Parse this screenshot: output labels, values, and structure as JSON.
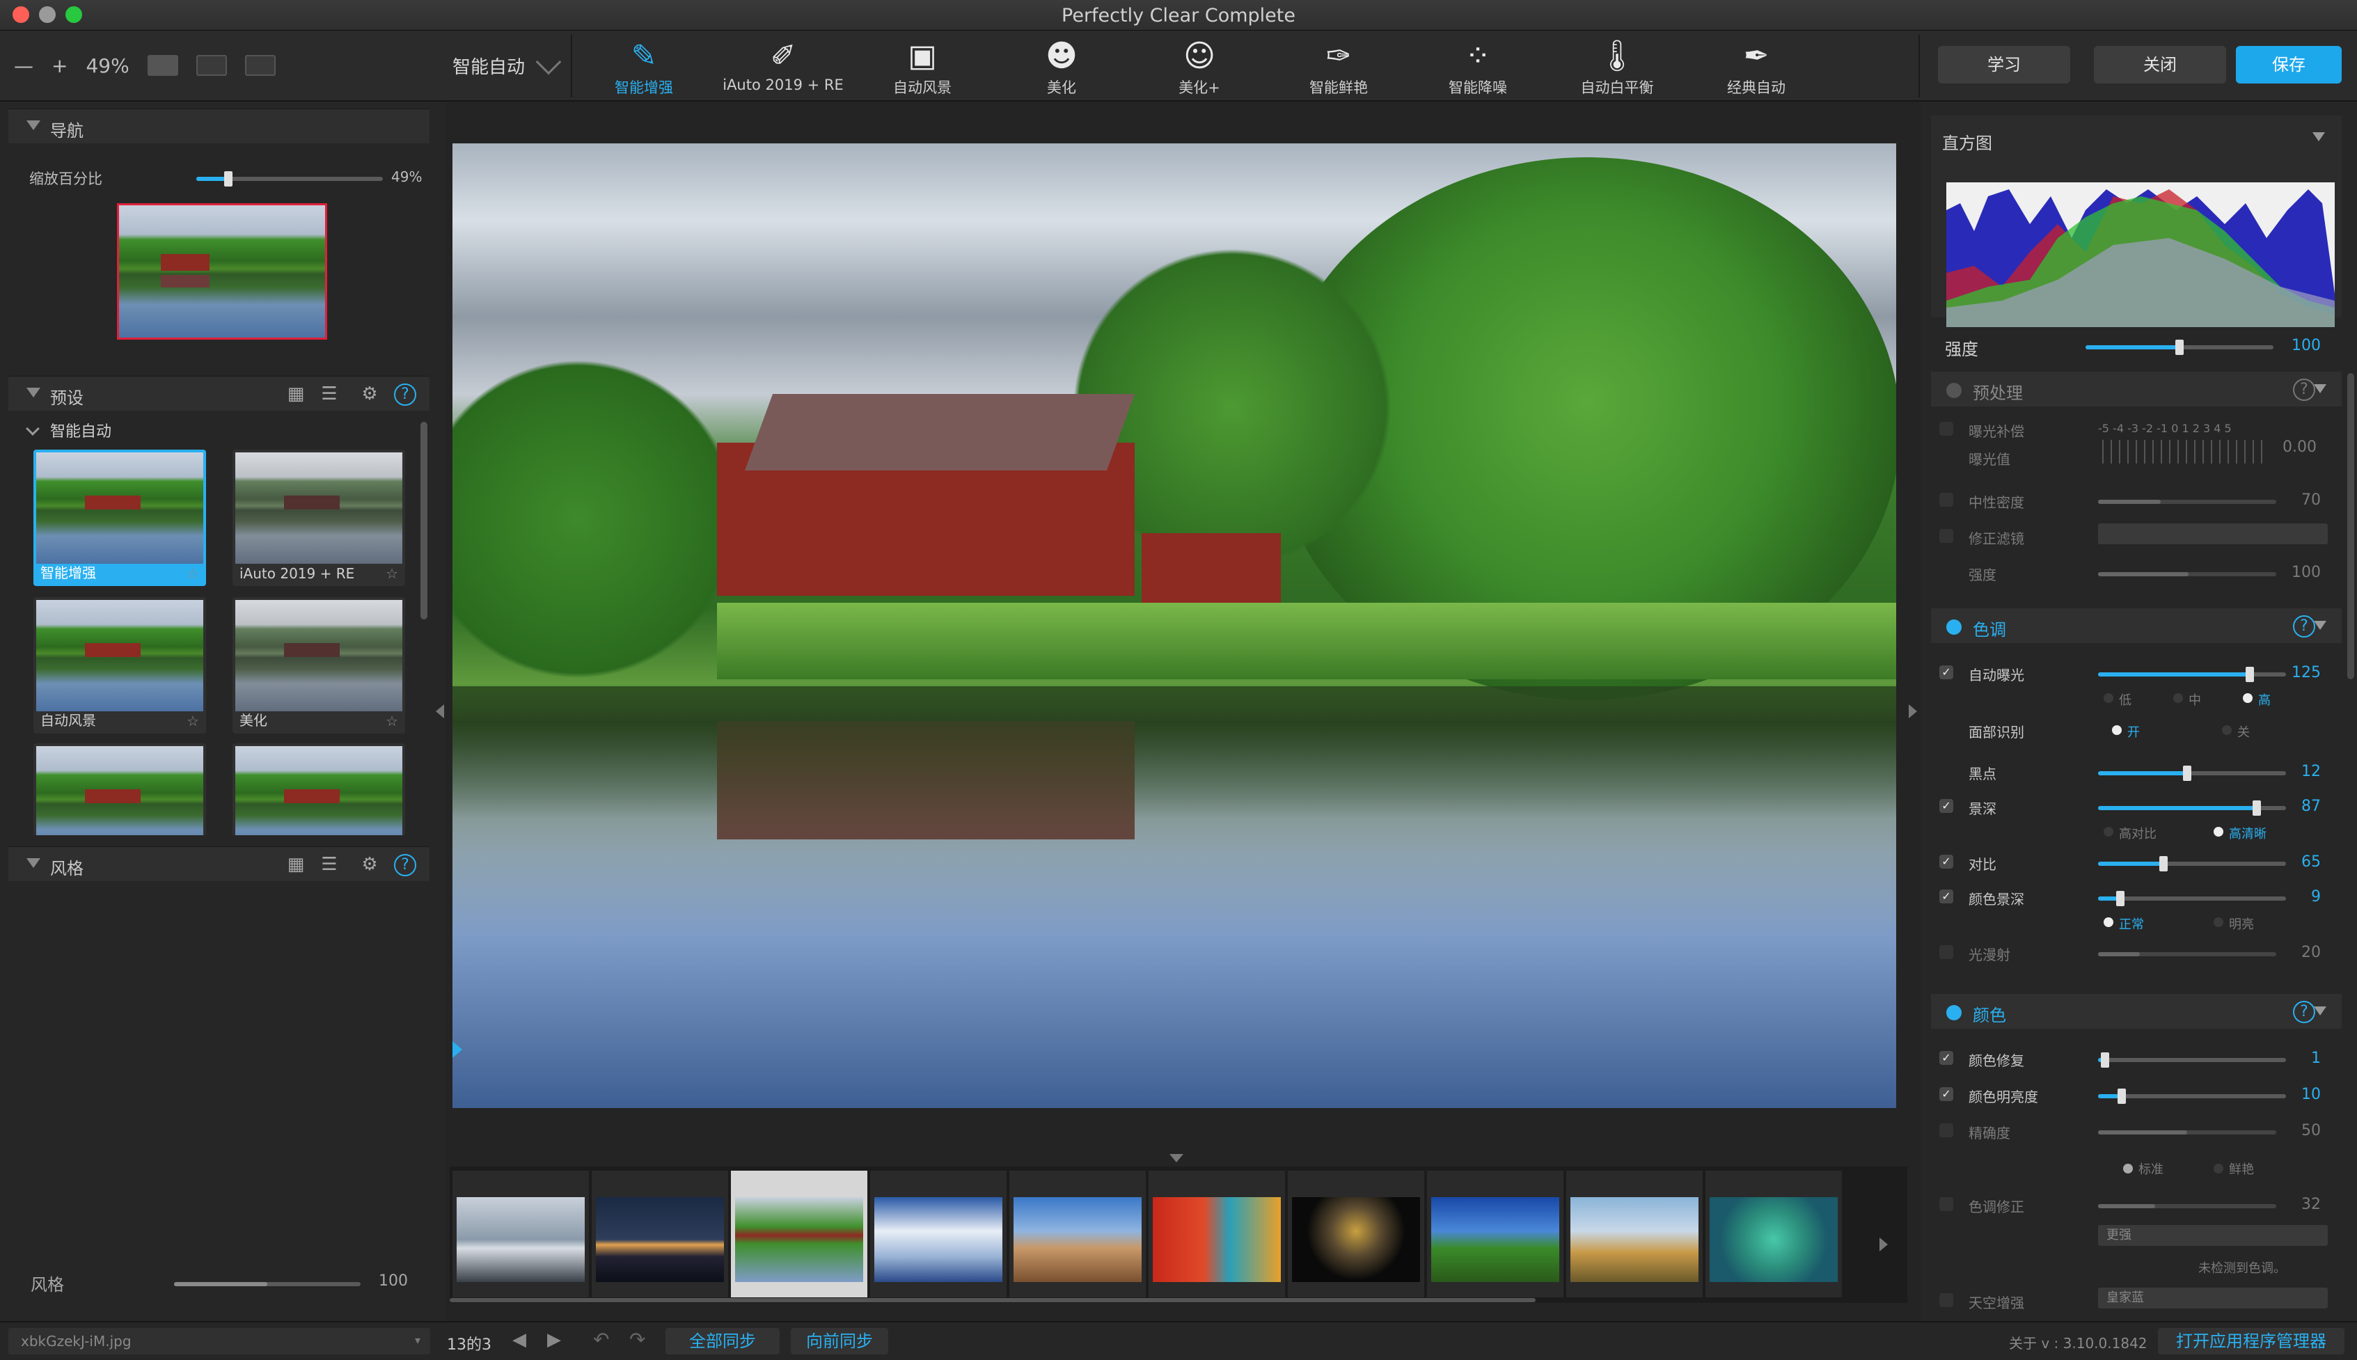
{
  "window": {
    "title": "Perfectly Clear Complete"
  },
  "toolbar": {
    "zoom_out": "—",
    "zoom_in": "+",
    "zoom": "49%",
    "preset_select": "智能自动",
    "tools": [
      {
        "label": "智能增强",
        "icon": "brush-2019-icon",
        "glyph": "✎"
      },
      {
        "label": "iAuto 2019 + RE",
        "icon": "brush-eye-icon",
        "glyph": "✐"
      },
      {
        "label": "自动风景",
        "icon": "landscape-icon",
        "glyph": "▣"
      },
      {
        "label": "美化",
        "icon": "face-icon",
        "glyph": "☻"
      },
      {
        "label": "美化+",
        "icon": "face-plus-icon",
        "glyph": "☺"
      },
      {
        "label": "智能鲜艳",
        "icon": "vivid-brush-icon",
        "glyph": "✑"
      },
      {
        "label": "智能降噪",
        "icon": "noise-icon",
        "glyph": "⁘"
      },
      {
        "label": "自动白平衡",
        "icon": "thermometer-icon",
        "glyph": "🌡"
      },
      {
        "label": "经典自动",
        "icon": "hd-brush-icon",
        "glyph": "✒"
      }
    ],
    "learn": "学习",
    "close": "关闭",
    "save": "保存"
  },
  "left": {
    "nav_title": "导航",
    "zoom_label": "缩放百分比",
    "zoom_value": "49%",
    "presets_title": "预设",
    "group_name": "智能自动",
    "presets": [
      {
        "name": "智能增强",
        "star": "☆"
      },
      {
        "name": "iAuto 2019 + RE",
        "star": "☆"
      },
      {
        "name": "自动风景",
        "star": "☆"
      },
      {
        "name": "美化",
        "star": "☆"
      },
      {
        "name": "",
        "star": ""
      },
      {
        "name": "",
        "star": ""
      }
    ],
    "styles_title": "风格",
    "style_label": "风格",
    "style_value": "100",
    "help": "?"
  },
  "filmstrip": {
    "selected_index": 2,
    "count": 10
  },
  "right": {
    "histogram_title": "直方图",
    "strength_label": "强度",
    "strength_value": "100",
    "pre": {
      "title": "预处理",
      "exp_comp": "曝光补偿",
      "exp_value_label": "曝光值",
      "exp_value": "0.00",
      "exp_scale": "-5 -4 -3 -2 -1 0 1 2 3 4 5",
      "nd": "中性密度",
      "nd_value": "70",
      "filter": "修正滤镜",
      "strength": "强度",
      "strength_value": "100"
    },
    "tone": {
      "title": "色调",
      "auto_exposure": "自动曝光",
      "auto_exposure_value": "125",
      "low": "低",
      "mid": "中",
      "high": "高",
      "face": "面部识别",
      "on": "开",
      "off": "关",
      "black": "黑点",
      "black_value": "12",
      "depth": "景深",
      "depth_value": "87",
      "high_contrast": "高对比",
      "high_def": "高清晰",
      "contrast": "对比",
      "contrast_value": "65",
      "color_depth": "颜色景深",
      "color_depth_value": "9",
      "normal": "正常",
      "bright": "明亮",
      "diffuse": "光漫射",
      "diffuse_value": "20"
    },
    "color": {
      "title": "颜色",
      "repair": "颜色修复",
      "repair_value": "1",
      "vibrance": "颜色明亮度",
      "vibrance_value": "10",
      "accuracy": "精确度",
      "accuracy_value": "50",
      "standard": "标准",
      "vivid": "鲜艳",
      "tint": "色调修正",
      "tint_value": "32",
      "tint_select": "更强",
      "tint_note": "未检测到色调。",
      "sky": "天空增强",
      "sky_select": "皇家蓝"
    }
  },
  "status": {
    "filename": "xbkGzekJ-iM.jpg",
    "counter": "13的3",
    "sync_all": "全部同步",
    "sync_forward": "向前同步",
    "about": "关于 v : 3.10.0.1842",
    "app_manager": "打开应用程序管理器"
  }
}
